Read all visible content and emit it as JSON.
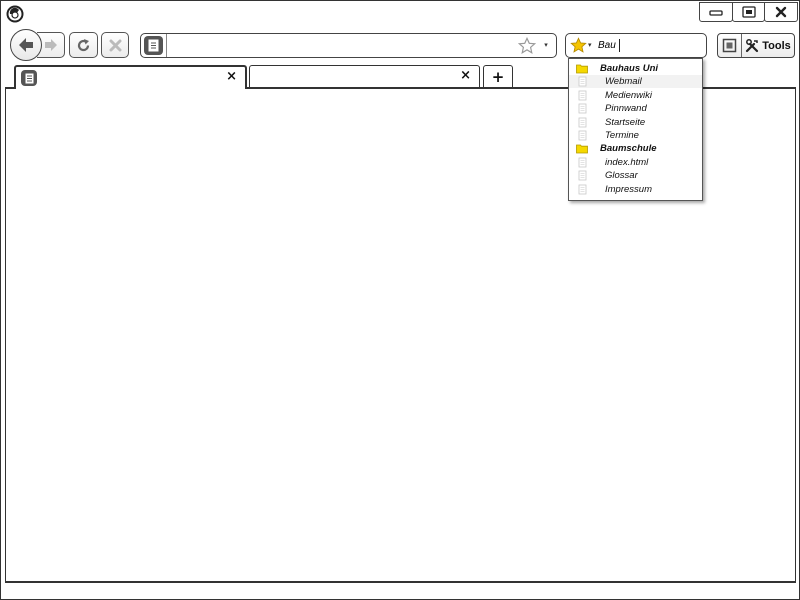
{
  "window": {
    "controls": [
      "minimize",
      "restore",
      "close"
    ]
  },
  "toolbar": {
    "tools_label": "Tools",
    "url_value": "",
    "search_value": "Bau"
  },
  "tabs": [
    {
      "label": ""
    },
    {
      "label": ""
    }
  ],
  "bookmarks_popup": {
    "items": [
      {
        "type": "folder",
        "label": "Bauhaus Uni"
      },
      {
        "type": "page",
        "label": "Webmail"
      },
      {
        "type": "page",
        "label": "Medienwiki"
      },
      {
        "type": "page",
        "label": "Pinnwand"
      },
      {
        "type": "page",
        "label": "Startseite"
      },
      {
        "type": "page",
        "label": "Termine"
      },
      {
        "type": "folder",
        "label": "Baumschule"
      },
      {
        "type": "page",
        "label": "index.html"
      },
      {
        "type": "page",
        "label": "Glossar"
      },
      {
        "type": "page",
        "label": "Impressum"
      }
    ]
  },
  "colors": {
    "folder": "#f5d800",
    "star": "#f5c400",
    "page_icon": "#c8c8c8"
  },
  "icons": {
    "close_tab": "×",
    "new_tab": "+",
    "dropdown": "▾"
  }
}
